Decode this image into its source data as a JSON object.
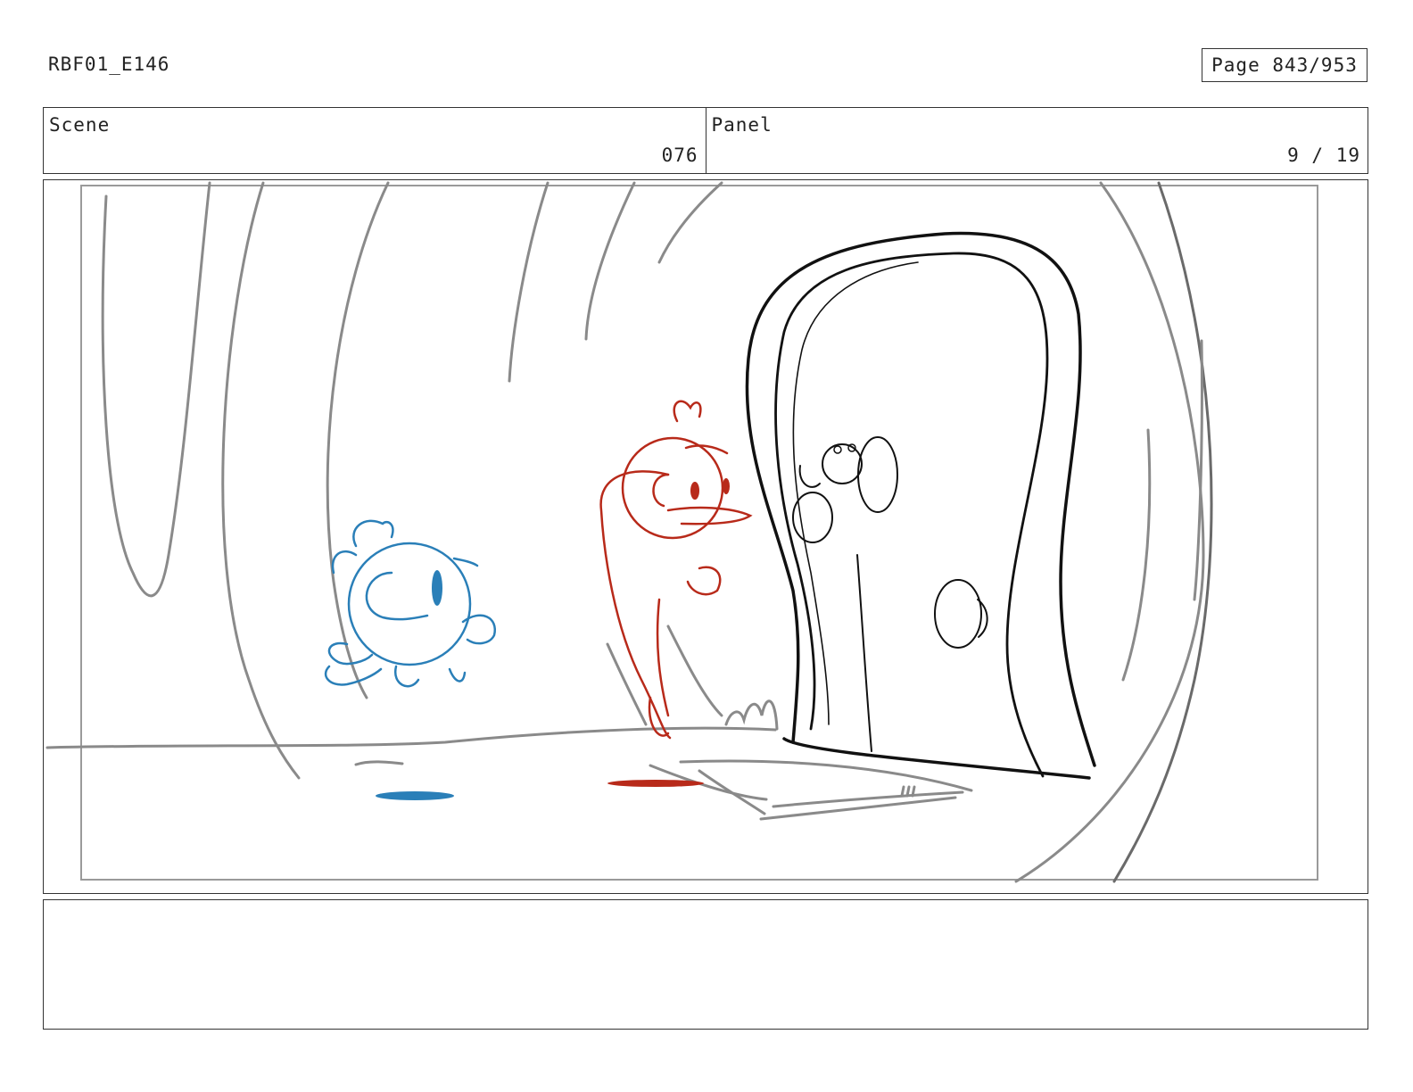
{
  "header": {
    "production_id": "RBF01_E146",
    "page_label": "Page 843/953"
  },
  "info": {
    "scene_label": "Scene",
    "scene_value": "076",
    "panel_label": "Panel",
    "panel_value": "9 / 19"
  },
  "colors": {
    "border": "#333333",
    "sketch_gray": "#8a8a8a",
    "door_black": "#111111",
    "blue_character": "#2a7fb8",
    "red_character": "#b82a1a"
  },
  "notes": {
    "text": ""
  }
}
